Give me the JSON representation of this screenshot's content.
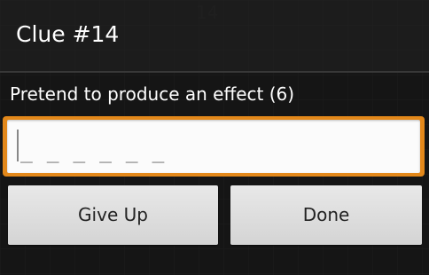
{
  "background": {
    "corner_number": "14"
  },
  "dialog": {
    "title": "Clue #14",
    "clue": "Pretend to produce an effect (6)",
    "input": {
      "value": "",
      "blanks": "_ _ _ _ _ _"
    },
    "buttons": {
      "give_up": "Give Up",
      "done": "Done"
    }
  },
  "colors": {
    "accent": "#e3881a"
  }
}
